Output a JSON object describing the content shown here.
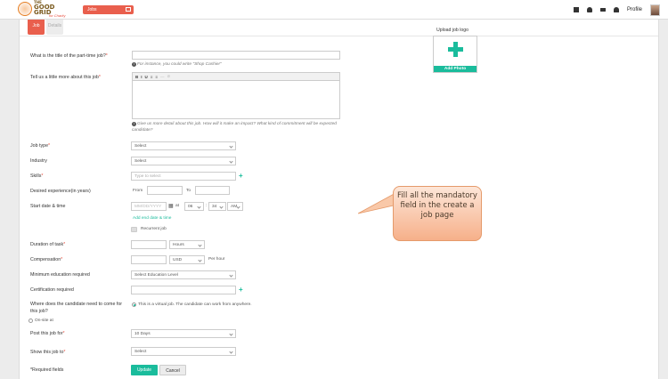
{
  "app": {
    "brand_line1": "THE",
    "brand_line2": "GOOD",
    "brand_line3": "GRID",
    "brand_tagline": "for Charity"
  },
  "header": {
    "section_label": "Jobs",
    "profile_label": "Profile"
  },
  "tabs": [
    {
      "label": "Job"
    },
    {
      "label": "Details"
    }
  ],
  "form": {
    "title": {
      "label": "What is the title of the part-time job?",
      "hint": "For instance, you could write \"Shop Cashier\""
    },
    "description": {
      "label": "Tell us a little more about this job",
      "hint": "Give us more detail about this job. How will it make an impact? What kind of commitment will be expected candidate?"
    },
    "job_type": {
      "label": "Job type",
      "value": "Select"
    },
    "industry": {
      "label": "Industry",
      "value": "Select"
    },
    "skills": {
      "label": "Skills",
      "placeholder": "Type to select"
    },
    "experience": {
      "label": "Desired experience(in years)",
      "from": "From",
      "to": "To"
    },
    "start": {
      "label": "Start date & time",
      "date_placeholder": "MM/DD/YYYY",
      "at": "at",
      "hour": "06",
      "minute": "34",
      "ampm": "AM",
      "add_end": "Add end date & time",
      "recurrent": "Recurrent job"
    },
    "duration": {
      "label": "Duration of task",
      "unit": "Hours"
    },
    "compensation": {
      "label": "Compensation",
      "currency": "USD",
      "per": "Per hour"
    },
    "education": {
      "label": "Minimum education required",
      "value": "Select Education Level"
    },
    "certification": {
      "label": "Certification required"
    },
    "location": {
      "label": "Where does the candidate need to come for this job?",
      "option_virtual": "This is a virtual job. The candidate can work from anywhere.",
      "option_onsite": "On-site at"
    },
    "post_for": {
      "label": "Post this job for",
      "value": "10 Days"
    },
    "show_to": {
      "label": "Show this job to",
      "value": "Select"
    },
    "required_note": "*Required fields",
    "update_label": "Update",
    "cancel_label": "Cancel"
  },
  "upload": {
    "title": "Upload job logo",
    "button": "Add Photo"
  },
  "editor_toolbar": [
    "B",
    "I",
    "U",
    "≡",
    "≡",
    "—",
    "⊘"
  ],
  "callout": {
    "text": "Fill all the mandatory field in the create a job page"
  },
  "colors": {
    "accent": "#e95f4d",
    "primary": "#1abc9c",
    "callout_bg": "#f6b08a"
  }
}
